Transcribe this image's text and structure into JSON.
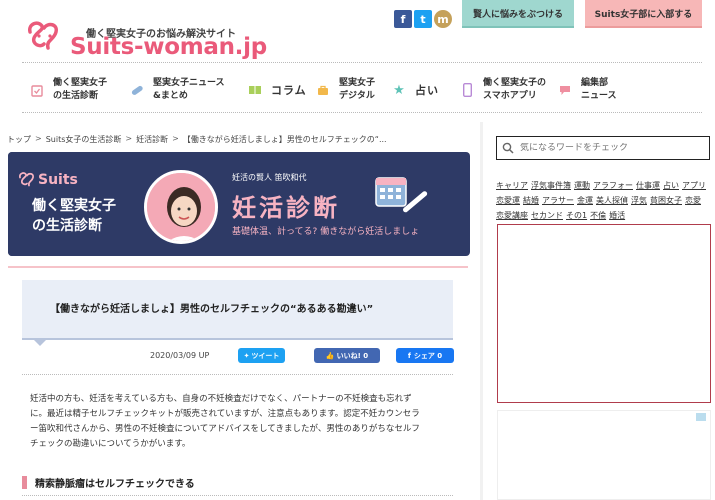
{
  "header": {
    "tagline": "働く堅実女子のお悩み解決サイト",
    "logo_main": "Suits",
    "logo_sub": "-woman.jp",
    "social": {
      "fb": "f",
      "tw": "t",
      "m": "m"
    },
    "tab_consult": "賢人に悩みをぶつける",
    "tab_join": "Suits女子部に入部する",
    "nav": [
      {
        "label": "働く堅実女子\nの生活診断"
      },
      {
        "label": "堅実女子ニュース\n&まとめ"
      },
      {
        "label": "コラム"
      },
      {
        "label": "堅実女子\nデジタル"
      },
      {
        "label": "占い"
      },
      {
        "label": "働く堅実女子の\nスマホアプリ"
      },
      {
        "label": "編集部\nニュース"
      }
    ]
  },
  "breadcrumb": [
    "トップ",
    "Suits女子の生活診断",
    "妊活診断",
    "【働きながら妊活しましょ】男性のセルフチェックの“..."
  ],
  "banner": {
    "suits": "Suits",
    "category": "働く堅実女子\nの生活診断",
    "author": "妊活の賢人 笛吹和代",
    "title": "妊活診断",
    "subtitle": "基礎体温、計ってる? 働きながら妊活しましょ"
  },
  "article": {
    "title": "【働きながら妊活しましょ】男性のセルフチェックの“あるある勘違い”",
    "date": "2020/03/09 UP",
    "tweet": "ツイート",
    "like": "いいね! 0",
    "share": "シェア 0",
    "body": [
      "妊活中の方も、妊活を考えている方も、自身の不妊検査だけでなく、パートナーの不妊検査も忘れず",
      "に。最近は精子セルフチェックキットが販売されていますが、注意点もあります。認定不妊カウンセラ",
      "ー笛吹和代さんから、男性の不妊検査についてアドバイスをしてきましたが、男性のありがちなセルフ",
      "チェックの勘違いについてうかがいます。"
    ],
    "section_heading": "精索静脈瘤はセルフチェックできる"
  },
  "sidebar": {
    "search_placeholder": "気になるワードをチェック",
    "tags": [
      "キャリア",
      "浮気事件簿",
      "運動",
      "アラフォー",
      "仕事運",
      "占い",
      "アプリ",
      "恋愛運",
      "結婚",
      "アラサー",
      "金運",
      "美人探偵",
      "浮気",
      "貧困女子",
      "恋愛",
      "恋愛講座",
      "セカンド",
      "その1",
      "不倫",
      "婚活"
    ]
  },
  "colors": {
    "brand_pink": "#ea5a7a",
    "banner_navy": "#2e3a66",
    "teal_tab": "#9fd7cf",
    "pink_tab": "#f7b7b7"
  }
}
